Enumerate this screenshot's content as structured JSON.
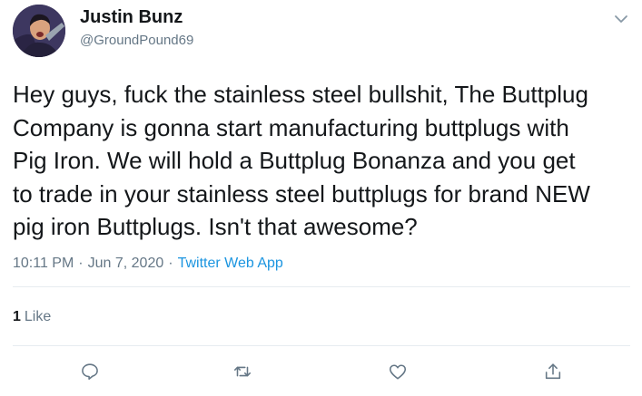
{
  "tweet": {
    "display_name": "Justin Bunz",
    "handle": "@GroundPound69",
    "text": "Hey guys, fuck the stainless steel bullshit, The Buttplug\nCompany is gonna start manufacturing buttplugs with\nPig Iron. We will hold a Buttplug Bonanza and you get\nto trade in your stainless steel buttplugs for brand NEW\npig iron Buttplugs. Isn't that awesome?",
    "time": "10:11 PM",
    "separator": "·",
    "date": "Jun 7, 2020",
    "source": "Twitter Web App",
    "like_count": "1",
    "like_label": "Like"
  },
  "icons": {
    "menu": "chevron-down-icon",
    "reply": "speech-bubble-icon",
    "retweet": "retweet-arrows-icon",
    "like": "heart-icon",
    "share": "share-upload-icon"
  },
  "colors": {
    "text": "#14171a",
    "secondary": "#657786",
    "link": "#1b95e0",
    "divider": "#e6ecf0"
  }
}
